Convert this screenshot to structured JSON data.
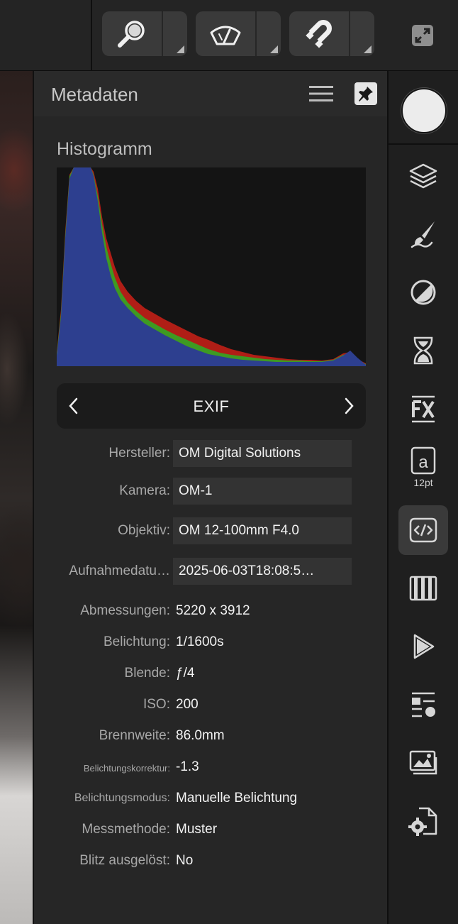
{
  "toolbar": {
    "tools": [
      {
        "name": "zoom-tool",
        "icon": "magnifier-icon"
      },
      {
        "name": "view-tool",
        "icon": "eye-dial-icon"
      },
      {
        "name": "snapping-tool",
        "icon": "magnet-icon"
      }
    ],
    "expand_icon": "expand-icon"
  },
  "panel": {
    "title": "Metadaten",
    "histogram_title": "Histogramm",
    "section_label": "EXIF",
    "fields": [
      {
        "label": "Hersteller:",
        "value": "OM Digital Solutions"
      },
      {
        "label": "Kamera:",
        "value": "OM-1"
      },
      {
        "label": "Objektiv:",
        "value": "OM 12-100mm F4.0"
      },
      {
        "label": "Aufnahmedatu…",
        "value": "2025-06-03T18:08:5…"
      }
    ],
    "details": [
      {
        "label": "Abmessungen:",
        "value": "5220 x 3912"
      },
      {
        "label": "Belichtung:",
        "value": "1/1600s"
      },
      {
        "label": "Blende:",
        "value": "ƒ/4"
      },
      {
        "label": "ISO:",
        "value": "200"
      },
      {
        "label": "Brennweite:",
        "value": "86.0mm"
      },
      {
        "label": "Belichtungskorrektur:",
        "value": "-1.3"
      },
      {
        "label": "Belichtungsmodus:",
        "value": "Manuelle Belichtung"
      },
      {
        "label": "Messmethode:",
        "value": "Muster"
      },
      {
        "label": "Blitz ausgelöst:",
        "value": "No"
      }
    ]
  },
  "sidebar": {
    "text_style_label": "a",
    "text_style_size": "12pt",
    "items": [
      "layers-icon",
      "brushes-icon",
      "adjustments-icon",
      "history-icon",
      "fx-icon",
      "text-styles-icon",
      "source-code-icon",
      "channels-icon",
      "play-icon",
      "styles-icon",
      "stock-images-icon",
      "document-settings-icon"
    ]
  },
  "colors": {
    "accent_blue": "#2d3f8f",
    "histogram_red": "#b01e16",
    "histogram_green": "#3e9a22"
  }
}
